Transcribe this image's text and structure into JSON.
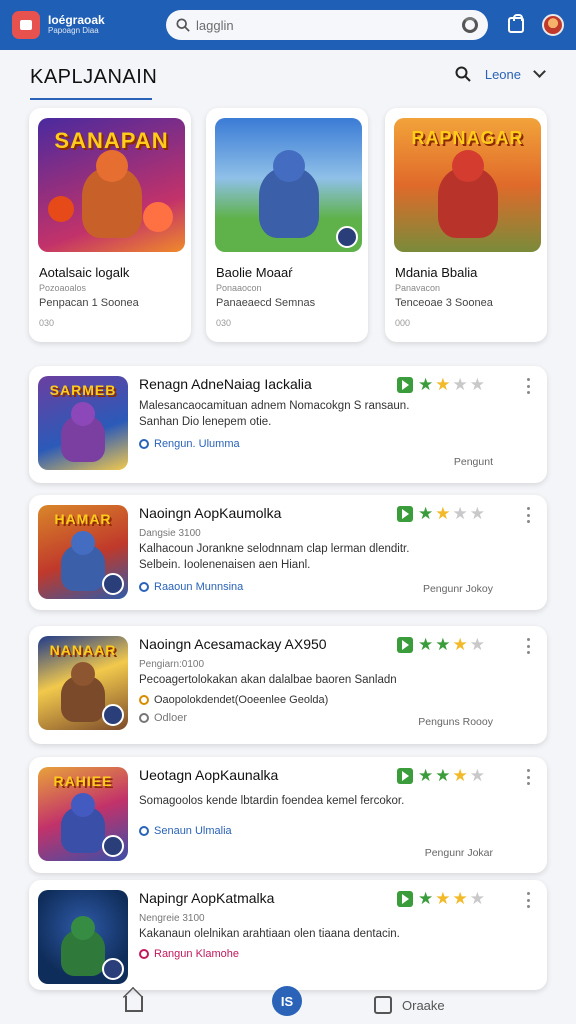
{
  "brand": {
    "title": "Ioégraoak",
    "subtitle": "Papoagn Diaa"
  },
  "search": {
    "placeholder": "lagglin"
  },
  "section": {
    "title": "KAPLJANAIN",
    "link": "Leone"
  },
  "featured": [
    {
      "banner": "SANAPAN",
      "title": "Aotalsaic logalk",
      "sub1": "Pozoaoalos",
      "sub2": "Penpacan 1 Soonea",
      "count": "030",
      "colors": [
        "#7b2fbe",
        "#e8533f"
      ]
    },
    {
      "banner": "",
      "title": "Baolie Moaaŕ",
      "sub1": "Ponaaocon",
      "sub2": "Panaeaecd Semnas",
      "count": "030",
      "colors": [
        "#3a7bd5",
        "#5fb24a"
      ]
    },
    {
      "banner": "RAPNAGAR",
      "title": "Mdania Bbalia",
      "sub1": "Panavacon",
      "sub2": "Tenceoae 3 Soonea",
      "count": "000",
      "colors": [
        "#f2a33a",
        "#7a3b8c"
      ]
    }
  ],
  "items": [
    {
      "banner": "SARMEB",
      "title": "Renagn AdneNaiag Iackalia",
      "sub": "",
      "desc": "Malesancaocamituan adnem Nomacokgn S ransaun. Sanhan Dio lenepem otie.",
      "tag": "Rengun. Ulumma",
      "tag_color": "#2a63b8",
      "right": "Pengunt",
      "stars": [
        "g",
        "y",
        "e",
        "e"
      ],
      "colors": [
        "#6b3fa0",
        "#f2c94c"
      ]
    },
    {
      "banner": "HAMAR",
      "title": "Naoingn AopKaumolka",
      "sub": "Dangsie 3100",
      "desc": "Kalhacoun Jorankne selodnnam clap lerman dlenditr. Selbein. Ioolenenaisen aen Hianl.",
      "tag": "Raaoun Munnsina",
      "tag_color": "#2a63b8",
      "right": "Pengunr Jokoy",
      "stars": [
        "g",
        "y",
        "e",
        "e"
      ],
      "colors": [
        "#d9862a",
        "#2e5aa8"
      ]
    },
    {
      "banner": "NANAAR",
      "title": "Naoingn Acesamackay AX950",
      "sub": "Pengiarn:0100",
      "desc": "Pecoagertolokakan akan dalalbae baoren Sanladn",
      "tag": "Oaopolokdendet(Ooeenlee Geolda)",
      "tag_color": "#d98c00",
      "extra": "Odloer",
      "right": "Penguns Roooy",
      "stars": [
        "g",
        "g",
        "y",
        "e"
      ],
      "colors": [
        "#1f3a8a",
        "#7b4a2a"
      ]
    },
    {
      "banner": "RAHIEE",
      "title": "Ueotagn AopKaunalka",
      "sub": "",
      "desc": "Somagoolos kende lbtardin foendea kemel fercokor.",
      "tag": "Senaun Ulmalia",
      "tag_color": "#2a63b8",
      "right": "Pengunr Jokar",
      "stars": [
        "g",
        "g",
        "y",
        "e"
      ],
      "colors": [
        "#e8a23a",
        "#3a4fa8"
      ]
    },
    {
      "banner": "",
      "title": "Napingr AopKatmalka",
      "sub": "Nengreie 3100",
      "desc": "Kakanaun olelnikan arahtiaan olen tiaana dentacin.",
      "tag": "Rangun Klamohe",
      "tag_color": "#c2185b",
      "right": "",
      "stars": [
        "g",
        "y",
        "y",
        "e"
      ],
      "colors": [
        "#0f2d5a",
        "#2f7a3a"
      ]
    }
  ],
  "bottom_nav": {
    "center": "IS",
    "right_label": "Oraake"
  }
}
